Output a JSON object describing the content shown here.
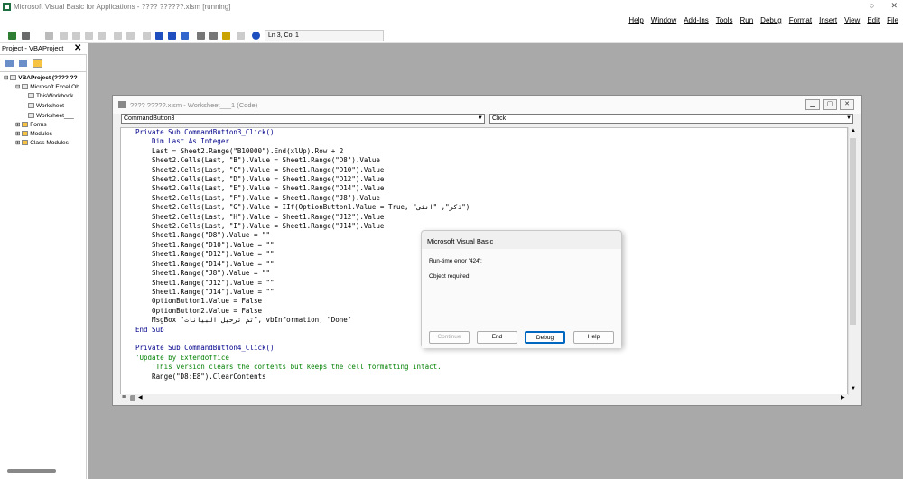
{
  "app": {
    "title": "Microsoft Visual Basic for Applications - ???? ??????.xlsm [running]"
  },
  "menu": [
    "File",
    "Edit",
    "View",
    "Insert",
    "Format",
    "Debug",
    "Run",
    "Tools",
    "Add-Ins",
    "Window",
    "Help"
  ],
  "toolbar": {
    "position": "Ln 3, Col 1"
  },
  "project": {
    "header": "Project - VBAProject",
    "tree": [
      "VBAProject (???? ??",
      "Microsoft Excel Ob",
      "ThisWorkbook",
      "Worksheet",
      "Worksheet___",
      "Forms",
      "Modules",
      "Class Modules"
    ]
  },
  "code_window": {
    "title": "???? ?????.xlsm - Worksheet___1 (Code)",
    "object": "CommandButton3",
    "procedure": "Click",
    "lines": [
      "Private Sub CommandButton3_Click()",
      "    Dim Last As Integer",
      "    Last = Sheet2.Range(\"B10000\").End(xlUp).Row + 2",
      "    Sheet2.Cells(Last, \"B\").Value = Sheet1.Range(\"D8\").Value",
      "    Sheet2.Cells(Last, \"C\").Value = Sheet1.Range(\"D10\").Value",
      "    Sheet2.Cells(Last, \"D\").Value = Sheet1.Range(\"D12\").Value",
      "    Sheet2.Cells(Last, \"E\").Value = Sheet1.Range(\"D14\").Value",
      "    Sheet2.Cells(Last, \"F\").Value = Sheet1.Range(\"J8\").Value",
      "    Sheet2.Cells(Last, \"G\").Value = IIf(OptionButton1.Value = True, \"ذكر\", \"انثى\")",
      "    Sheet2.Cells(Last, \"H\").Value = Sheet1.Range(\"J12\").Value",
      "    Sheet2.Cells(Last, \"I\").Value = Sheet1.Range(\"J14\").Value",
      "    Sheet1.Range(\"D8\").Value = \"\"",
      "    Sheet1.Range(\"D10\").Value = \"\"",
      "    Sheet1.Range(\"D12\").Value = \"\"",
      "    Sheet1.Range(\"D14\").Value = \"\"",
      "    Sheet1.Range(\"J8\").Value = \"\"",
      "    Sheet1.Range(\"J12\").Value = \"\"",
      "    Sheet1.Range(\"J14\").Value = \"\"",
      "    OptionButton1.Value = False",
      "    OptionButton2.Value = False",
      "    MsgBox \"تم ترحيل البيانات\", vbInformation, \"Done\"",
      "End Sub",
      "",
      "Private Sub CommandButton4_Click()",
      "'Update by Extendoffice",
      "    'This version clears the contents but keeps the cell formatting intact.",
      "    Range(\"D8:E8\").ClearContents"
    ]
  },
  "dialog": {
    "title": "Microsoft Visual Basic",
    "error": "Run-time error '424':",
    "message": "Object required",
    "buttons": [
      "Continue",
      "End",
      "Debug",
      "Help"
    ]
  }
}
